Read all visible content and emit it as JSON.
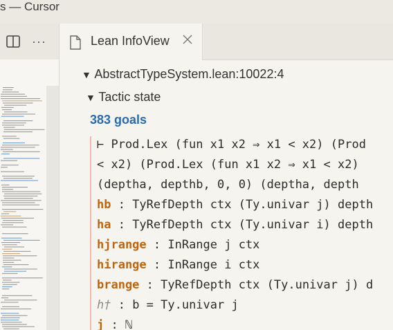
{
  "window": {
    "title": "s — Cursor"
  },
  "toolbar": {
    "more_label": "···"
  },
  "tab": {
    "label": "Lean InfoView"
  },
  "infoview": {
    "location": "AbstractTypeSystem.lean:10022:4",
    "tactic_state_label": "Tactic state",
    "goals_count": "383 goals",
    "goal_lines": [
      "⊢ Prod.Lex (fun x1 x2 ⇒ x1 < x2) (Prod",
      "< x2) (Prod.Lex (fun x1 x2 ⇒ x1 < x2)",
      "  (deptha, depthb, 0, 0) (deptha, depth"
    ],
    "hypotheses": [
      {
        "name": "hb",
        "type": " : TyRefDepth ctx (Ty.univar j) depth"
      },
      {
        "name": "ha",
        "type": " : TyRefDepth ctx (Ty.univar i) depth"
      },
      {
        "name": "hjrange",
        "type": " : InRange j ctx"
      },
      {
        "name": "hirange",
        "type": " : InRange i ctx"
      },
      {
        "name": "brange",
        "type": " : TyRefDepth ctx (Ty.univar j) d"
      },
      {
        "name": "h†",
        "type": " : b = Ty.univar j"
      },
      {
        "name": "j",
        "type": " : ℕ"
      }
    ]
  },
  "colors": {
    "accent": "#2a6bb0",
    "hypothesis": "#c0640c",
    "goal_border": "#f2b8ac"
  }
}
